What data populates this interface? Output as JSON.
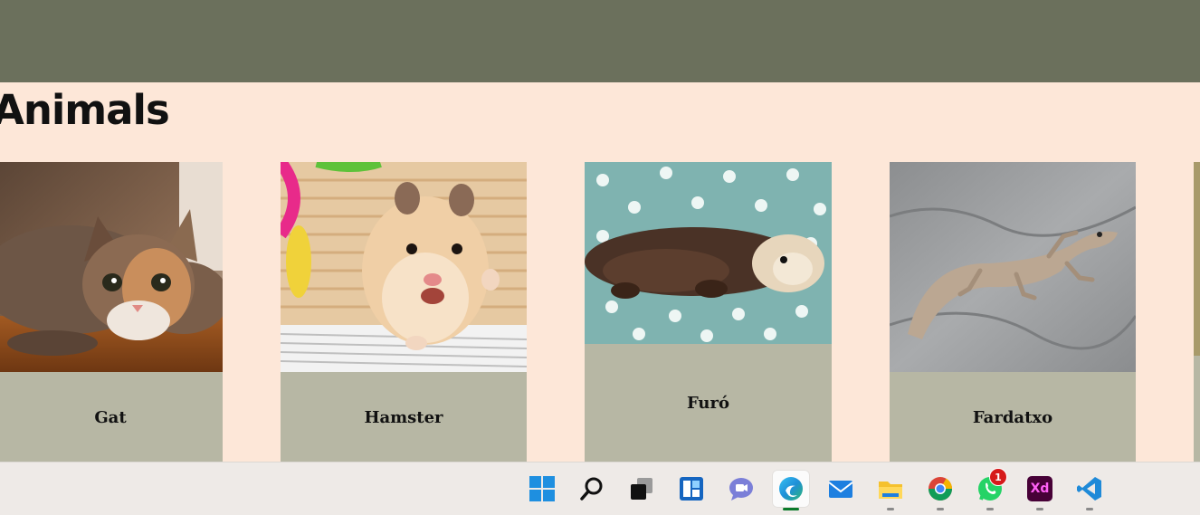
{
  "page": {
    "title": "Animals",
    "colors": {
      "header": "#6b705c",
      "background": "#fde7d8",
      "card": "#b7b7a4"
    }
  },
  "cards": [
    {
      "label": "Gat",
      "image": "cat-photo"
    },
    {
      "label": "Hamster",
      "image": "hamster-photo"
    },
    {
      "label": "Furó",
      "image": "ferret-photo"
    },
    {
      "label": "Fardatxo",
      "image": "lizard-photo"
    }
  ],
  "taskbar": {
    "icons": [
      {
        "name": "start-windows-icon"
      },
      {
        "name": "search-icon"
      },
      {
        "name": "task-view-icon"
      },
      {
        "name": "widgets-icon"
      },
      {
        "name": "chat-icon"
      },
      {
        "name": "edge-browser-icon",
        "active": true
      },
      {
        "name": "mail-icon"
      },
      {
        "name": "file-explorer-icon"
      },
      {
        "name": "chrome-icon"
      },
      {
        "name": "whatsapp-icon",
        "badge": "1"
      },
      {
        "name": "adobe-xd-icon",
        "text": "Xd"
      },
      {
        "name": "vscode-icon"
      }
    ]
  }
}
